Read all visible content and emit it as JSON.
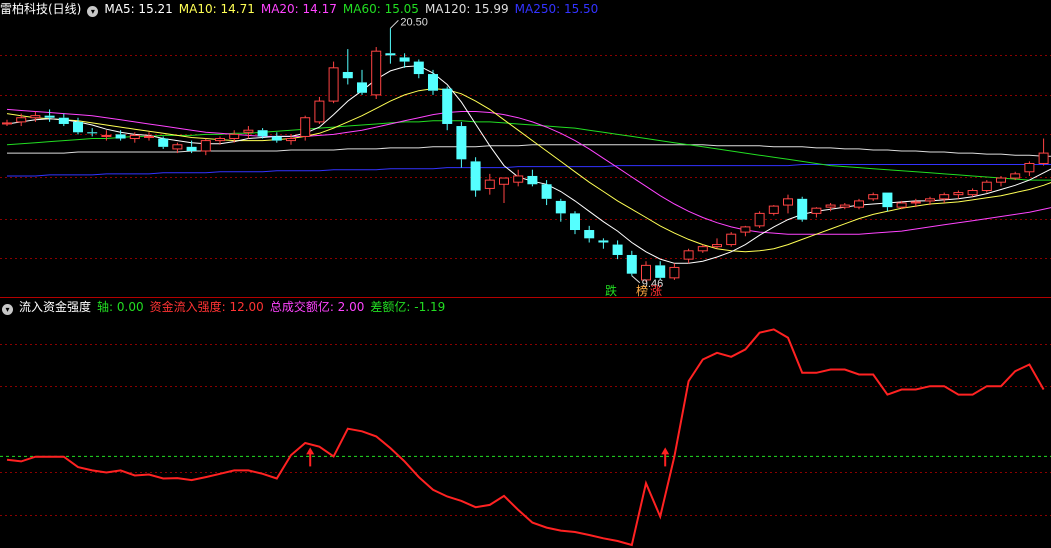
{
  "top_panel": {
    "stock_name": "雷柏科技(日线)",
    "ma_labels": [
      {
        "text": "MA5: 15.21",
        "color": "#ffffff"
      },
      {
        "text": "MA10: 14.71",
        "color": "#ffff55"
      },
      {
        "text": "MA20: 14.17",
        "color": "#ff44ff"
      },
      {
        "text": "MA60: 15.05",
        "color": "#22dd22"
      },
      {
        "text": "MA120: 15.99",
        "color": "#dddddd"
      },
      {
        "text": "MA250: 15.50",
        "color": "#3333ff"
      }
    ],
    "high_label": "20.50",
    "low_label": "9.46",
    "marker_down": "跌",
    "marker_tag1": "榜",
    "marker_tag2": "涨"
  },
  "bottom_panel": {
    "indicator_name": "流入资金强度",
    "labels": [
      {
        "text": "轴: 0.00",
        "color": "#22dd22"
      },
      {
        "text": "资金流入强度: 12.00",
        "color": "#ff3333"
      },
      {
        "text": "总成交额亿: 2.00",
        "color": "#ff44ff"
      },
      {
        "text": "差额亿: -1.19",
        "color": "#22dd22"
      }
    ]
  },
  "colors": {
    "up": "#ff4444",
    "down": "#55ffff",
    "grid": "#8b0000",
    "ma5": "#ffffff",
    "ma10": "#ffff55",
    "ma20": "#ff44ff",
    "ma60": "#22dd22",
    "ma120": "#dddddd",
    "ma250": "#3333ff",
    "flow": "#ff2222",
    "axis": "#22dd22"
  },
  "chart_data": [
    {
      "type": "candlestick",
      "candles": [
        [
          15.9,
          16.1,
          15.8,
          15.95
        ],
        [
          16.0,
          16.4,
          15.8,
          16.2
        ],
        [
          16.2,
          16.5,
          16.0,
          16.3
        ],
        [
          16.3,
          16.6,
          16.0,
          16.2
        ],
        [
          16.2,
          16.4,
          15.8,
          15.9
        ],
        [
          16.0,
          16.2,
          15.4,
          15.5
        ],
        [
          15.5,
          15.7,
          15.3,
          15.45
        ],
        [
          15.3,
          15.6,
          15.1,
          15.35
        ],
        [
          15.4,
          15.6,
          15.1,
          15.2
        ],
        [
          15.2,
          15.5,
          15.0,
          15.35
        ],
        [
          15.3,
          15.5,
          15.1,
          15.3
        ],
        [
          15.2,
          15.3,
          14.7,
          14.8
        ],
        [
          14.7,
          15.0,
          14.5,
          14.9
        ],
        [
          14.8,
          15.1,
          14.5,
          14.6
        ],
        [
          14.6,
          15.2,
          14.4,
          15.1
        ],
        [
          15.1,
          15.3,
          14.9,
          15.2
        ],
        [
          15.2,
          15.6,
          15.0,
          15.4
        ],
        [
          15.5,
          15.8,
          15.2,
          15.6
        ],
        [
          15.6,
          15.7,
          15.2,
          15.3
        ],
        [
          15.3,
          15.5,
          15.0,
          15.1
        ],
        [
          15.1,
          15.4,
          14.9,
          15.2
        ],
        [
          15.3,
          16.3,
          15.1,
          16.2
        ],
        [
          16.0,
          17.2,
          15.9,
          17.0
        ],
        [
          17.0,
          18.9,
          16.9,
          18.6
        ],
        [
          18.4,
          19.5,
          17.8,
          18.1
        ],
        [
          17.9,
          18.5,
          17.3,
          17.4
        ],
        [
          17.3,
          19.6,
          17.1,
          19.4
        ],
        [
          19.3,
          20.5,
          18.8,
          19.2
        ],
        [
          19.1,
          19.3,
          18.6,
          18.9
        ],
        [
          18.9,
          19.0,
          18.1,
          18.3
        ],
        [
          18.3,
          18.5,
          17.3,
          17.5
        ],
        [
          17.6,
          17.7,
          15.6,
          15.9
        ],
        [
          15.8,
          16.0,
          13.8,
          14.2
        ],
        [
          14.1,
          14.3,
          12.4,
          12.7
        ],
        [
          12.8,
          13.5,
          12.5,
          13.2
        ],
        [
          13.0,
          13.3,
          12.1,
          13.3
        ],
        [
          13.1,
          13.7,
          12.9,
          13.4
        ],
        [
          13.4,
          13.7,
          12.9,
          13.0
        ],
        [
          13.0,
          13.2,
          12.0,
          12.3
        ],
        [
          12.2,
          12.3,
          11.2,
          11.6
        ],
        [
          11.6,
          11.7,
          10.6,
          10.8
        ],
        [
          10.8,
          11.0,
          10.2,
          10.4
        ],
        [
          10.3,
          10.4,
          9.9,
          10.2
        ],
        [
          10.1,
          10.3,
          9.4,
          9.6
        ],
        [
          9.6,
          9.8,
          8.6,
          8.7
        ],
        [
          8.4,
          9.3,
          8.3,
          9.1
        ],
        [
          9.1,
          9.3,
          8.4,
          8.5
        ],
        [
          8.5,
          9.2,
          8.4,
          9.0
        ],
        [
          9.4,
          9.9,
          9.2,
          9.8
        ],
        [
          9.8,
          10.1,
          9.7,
          10.0
        ],
        [
          10.0,
          10.4,
          9.9,
          10.1
        ],
        [
          10.1,
          10.7,
          10.0,
          10.6
        ],
        [
          10.7,
          11.0,
          10.5,
          10.95
        ],
        [
          11.0,
          11.7,
          10.9,
          11.6
        ],
        [
          11.6,
          12.0,
          11.5,
          11.95
        ],
        [
          12.0,
          12.5,
          11.6,
          12.3
        ],
        [
          12.3,
          12.4,
          11.2,
          11.3
        ],
        [
          11.6,
          11.9,
          11.4,
          11.85
        ],
        [
          11.9,
          12.1,
          11.7,
          12.0
        ],
        [
          11.9,
          12.1,
          11.8,
          12.0
        ],
        [
          11.9,
          12.3,
          11.8,
          12.2
        ],
        [
          12.3,
          12.6,
          12.2,
          12.5
        ],
        [
          12.6,
          12.6,
          11.7,
          11.9
        ],
        [
          11.9,
          12.2,
          11.8,
          12.1
        ],
        [
          12.1,
          12.3,
          11.9,
          12.15
        ],
        [
          12.2,
          12.4,
          12.0,
          12.3
        ],
        [
          12.3,
          12.6,
          12.1,
          12.5
        ],
        [
          12.5,
          12.7,
          12.3,
          12.6
        ],
        [
          12.5,
          12.8,
          12.4,
          12.7
        ],
        [
          12.7,
          13.2,
          12.6,
          13.1
        ],
        [
          13.1,
          13.4,
          12.9,
          13.3
        ],
        [
          13.3,
          13.6,
          13.2,
          13.5
        ],
        [
          13.6,
          14.1,
          13.4,
          14.0
        ],
        [
          14.0,
          15.2,
          13.9,
          14.5
        ],
        [
          14.3,
          14.4,
          13.6,
          13.8
        ]
      ],
      "ma5": [
        15.9,
        16.0,
        16.1,
        16.15,
        16.1,
        16.0,
        15.85,
        15.65,
        15.5,
        15.4,
        15.35,
        15.2,
        15.1,
        15.0,
        14.95,
        14.95,
        15.05,
        15.2,
        15.25,
        15.3,
        15.3,
        15.45,
        15.75,
        16.35,
        17.0,
        17.5,
        18.05,
        18.45,
        18.65,
        18.7,
        18.35,
        17.8,
        16.95,
        15.9,
        14.85,
        13.9,
        13.35,
        13.15,
        13.0,
        12.65,
        12.2,
        11.7,
        11.2,
        10.75,
        10.2,
        9.75,
        9.4,
        9.2,
        9.2,
        9.3,
        9.5,
        9.75,
        10.1,
        10.55,
        10.95,
        11.3,
        11.55,
        11.7,
        11.8,
        11.9,
        12.0,
        12.05,
        12.1,
        12.15,
        12.2,
        12.2,
        12.25,
        12.3,
        12.4,
        12.55,
        12.75,
        12.95,
        13.2,
        13.55,
        13.9
      ],
      "ma10": [
        16.4,
        16.3,
        16.2,
        16.15,
        16.1,
        16.05,
        15.95,
        15.85,
        15.75,
        15.65,
        15.55,
        15.45,
        15.35,
        15.25,
        15.2,
        15.15,
        15.1,
        15.1,
        15.1,
        15.15,
        15.2,
        15.3,
        15.45,
        15.7,
        16.0,
        16.3,
        16.65,
        17.0,
        17.3,
        17.5,
        17.6,
        17.55,
        17.35,
        17.0,
        16.6,
        16.1,
        15.6,
        15.1,
        14.6,
        14.1,
        13.6,
        13.1,
        12.65,
        12.2,
        11.8,
        11.4,
        11.0,
        10.65,
        10.35,
        10.1,
        9.9,
        9.8,
        9.75,
        9.8,
        9.9,
        10.1,
        10.35,
        10.6,
        10.85,
        11.1,
        11.35,
        11.55,
        11.7,
        11.85,
        11.95,
        12.05,
        12.1,
        12.15,
        12.25,
        12.35,
        12.45,
        12.6,
        12.75,
        12.95,
        13.2
      ],
      "ma20": [
        16.6,
        16.55,
        16.5,
        16.45,
        16.4,
        16.35,
        16.3,
        16.2,
        16.1,
        16.0,
        15.9,
        15.8,
        15.7,
        15.6,
        15.5,
        15.45,
        15.4,
        15.35,
        15.3,
        15.3,
        15.3,
        15.3,
        15.35,
        15.4,
        15.5,
        15.6,
        15.75,
        15.9,
        16.05,
        16.2,
        16.35,
        16.45,
        16.5,
        16.5,
        16.45,
        16.35,
        16.2,
        16.0,
        15.75,
        15.45,
        15.1,
        14.7,
        14.25,
        13.8,
        13.35,
        12.9,
        12.45,
        12.05,
        11.7,
        11.4,
        11.15,
        10.95,
        10.8,
        10.7,
        10.65,
        10.6,
        10.6,
        10.6,
        10.6,
        10.6,
        10.6,
        10.65,
        10.7,
        10.75,
        10.85,
        10.95,
        11.05,
        11.15,
        11.25,
        11.35,
        11.45,
        11.55,
        11.65,
        11.8,
        11.95
      ],
      "ma60": [
        14.9,
        14.95,
        15.0,
        15.05,
        15.1,
        15.15,
        15.2,
        15.2,
        15.25,
        15.3,
        15.3,
        15.35,
        15.35,
        15.35,
        15.4,
        15.4,
        15.45,
        15.45,
        15.5,
        15.55,
        15.6,
        15.65,
        15.7,
        15.75,
        15.8,
        15.85,
        15.9,
        15.95,
        16.0,
        16.0,
        16.05,
        16.05,
        16.05,
        16.0,
        16.0,
        15.95,
        15.9,
        15.85,
        15.8,
        15.75,
        15.7,
        15.6,
        15.5,
        15.4,
        15.3,
        15.2,
        15.1,
        15.0,
        14.9,
        14.8,
        14.7,
        14.6,
        14.5,
        14.4,
        14.3,
        14.2,
        14.1,
        14.0,
        13.9,
        13.85,
        13.8,
        13.75,
        13.7,
        13.65,
        13.6,
        13.55,
        13.5,
        13.45,
        13.4,
        13.35,
        13.3,
        13.25,
        13.2,
        13.2,
        13.2
      ],
      "ma120": [
        14.5,
        14.5,
        14.5,
        14.5,
        14.5,
        14.55,
        14.55,
        14.55,
        14.55,
        14.55,
        14.55,
        14.55,
        14.55,
        14.6,
        14.6,
        14.6,
        14.6,
        14.6,
        14.6,
        14.6,
        14.65,
        14.65,
        14.65,
        14.65,
        14.7,
        14.7,
        14.7,
        14.75,
        14.75,
        14.75,
        14.8,
        14.8,
        14.8,
        14.8,
        14.85,
        14.85,
        14.85,
        14.9,
        14.9,
        14.9,
        14.9,
        14.9,
        14.9,
        14.9,
        14.9,
        14.9,
        14.9,
        14.9,
        14.9,
        14.9,
        14.85,
        14.85,
        14.85,
        14.85,
        14.8,
        14.8,
        14.8,
        14.75,
        14.75,
        14.7,
        14.7,
        14.65,
        14.65,
        14.6,
        14.6,
        14.55,
        14.55,
        14.5,
        14.5,
        14.45,
        14.45,
        14.4,
        14.4,
        14.35,
        14.35
      ],
      "ma250": [
        13.4,
        13.4,
        13.4,
        13.45,
        13.45,
        13.45,
        13.45,
        13.5,
        13.5,
        13.5,
        13.5,
        13.55,
        13.55,
        13.55,
        13.55,
        13.6,
        13.6,
        13.6,
        13.6,
        13.65,
        13.65,
        13.65,
        13.65,
        13.7,
        13.7,
        13.7,
        13.7,
        13.75,
        13.75,
        13.75,
        13.75,
        13.8,
        13.8,
        13.8,
        13.8,
        13.8,
        13.85,
        13.85,
        13.85,
        13.85,
        13.85,
        13.85,
        13.85,
        13.9,
        13.9,
        13.9,
        13.9,
        13.9,
        13.9,
        13.9,
        13.9,
        13.9,
        13.9,
        13.9,
        13.9,
        13.9,
        13.95,
        13.95,
        13.95,
        13.95,
        13.95,
        13.95,
        13.95,
        13.95,
        13.95,
        13.95,
        13.95,
        13.95,
        13.95,
        13.95,
        13.95,
        13.95,
        13.95,
        13.95,
        13.95
      ],
      "ylim": [
        8.3,
        20.9
      ]
    },
    {
      "type": "line",
      "series": [
        {
          "name": "资金流入强度",
          "values": [
            9.0,
            8.5,
            9.9,
            9.9,
            9.9,
            6.8,
            5.8,
            5.2,
            5.8,
            4.3,
            4.6,
            3.4,
            3.5,
            2.9,
            3.8,
            4.8,
            5.8,
            5.8,
            4.8,
            3.4,
            10.4,
            14.0,
            12.9,
            10.0,
            18.3,
            17.5,
            16.0,
            12.5,
            8.5,
            3.8,
            0.0,
            -2.0,
            -3.3,
            -5.2,
            -4.5,
            -1.8,
            -6.0,
            -9.8,
            -11.3,
            -12.2,
            -12.6,
            -13.5,
            -14.5,
            -15.3,
            -16.5,
            2.0,
            -8.0,
            10.0,
            32.5,
            39.0,
            41.0,
            39.8,
            42.0,
            47.0,
            48.0,
            45.5,
            35.0,
            35.0,
            36.0,
            36.0,
            34.5,
            34.5,
            28.5,
            30.0,
            30.0,
            31.0,
            31.0,
            28.5,
            28.5,
            31.0,
            31.0,
            35.5,
            37.5,
            30.0
          ]
        }
      ],
      "axis_value": 10.0,
      "arrows_at": [
        21,
        46
      ],
      "ylim": [
        -16.5,
        52
      ]
    }
  ]
}
